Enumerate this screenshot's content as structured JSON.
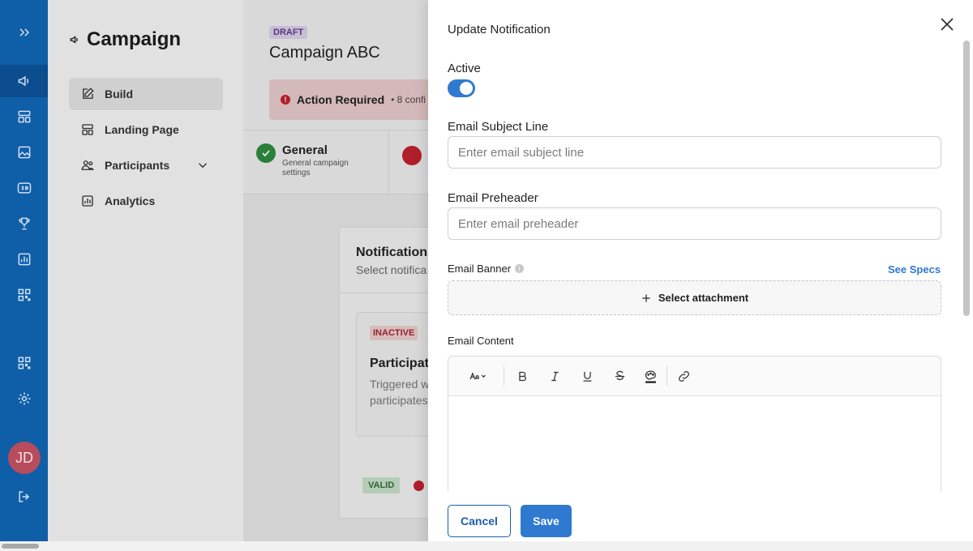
{
  "rail": {
    "expand_icon": "chevrons-right-icon",
    "avatar_initials": "JD",
    "accent": "#0f5ea8"
  },
  "sidenav": {
    "title": "Campaign",
    "items": [
      {
        "label": "Build",
        "icon": "edit-icon",
        "active": true
      },
      {
        "label": "Landing Page",
        "icon": "layout-icon"
      },
      {
        "label": "Participants",
        "icon": "users-icon"
      },
      {
        "label": "Analytics",
        "icon": "chart-icon"
      }
    ]
  },
  "main": {
    "status_badge": "DRAFT",
    "campaign_name": "Campaign ABC",
    "alert_title": "Action Required",
    "alert_sub": "• 8 confi",
    "step_general_title": "General",
    "step_general_sub": "General campaign settings",
    "card_title": "Notifications",
    "card_sub": "Select notifica",
    "notif_badge": "INACTIVE",
    "notif_title": "Participate",
    "notif_desc": "Triggered w participates",
    "valid_badge": "VALID"
  },
  "drawer": {
    "title": "Update Notification",
    "active_label": "Active",
    "subject_label": "Email Subject Line",
    "subject_placeholder": "Enter email subject line",
    "preheader_label": "Email Preheader",
    "preheader_placeholder": "Enter email preheader",
    "banner_label": "Email Banner",
    "see_specs": "See Specs",
    "attach_label": "Select attachment",
    "content_label": "Email Content",
    "cancel": "Cancel",
    "save": "Save"
  },
  "colors": {
    "primary": "#2f7ad0",
    "danger": "#c0222e",
    "success": "#2e8a3e"
  }
}
